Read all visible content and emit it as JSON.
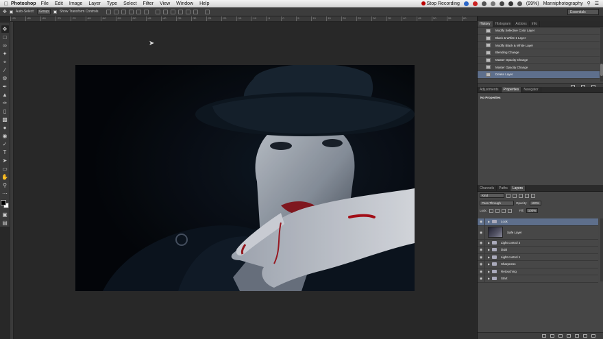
{
  "menubar": {
    "app": "Photoshop",
    "menus": [
      "File",
      "Edit",
      "Image",
      "Layer",
      "Type",
      "Select",
      "Filter",
      "View",
      "Window",
      "Help"
    ],
    "stop_recording": "Stop Recording",
    "battery": "(99%)",
    "user": "Manniphotography"
  },
  "options": {
    "auto_select": "Auto-Select:",
    "group": "Group",
    "show_transform": "Show Transform Controls",
    "workspace": "Essentials"
  },
  "ruler": {
    "ticks": [
      "-90",
      "-85",
      "-80",
      "-75",
      "-70",
      "-65",
      "-60",
      "-55",
      "-50",
      "-45",
      "-40",
      "-35",
      "-30",
      "-25",
      "-20",
      "-15",
      "-10",
      "-5",
      "0",
      "5",
      "10",
      "15",
      "20",
      "25",
      "30",
      "35",
      "40",
      "45",
      "50",
      "55",
      "60"
    ]
  },
  "history": {
    "tabs": [
      "History",
      "Histogram",
      "Actions",
      "Info"
    ],
    "items": [
      "Modify Selective Color Layer",
      "Black & White 1 Layer",
      "Modify Black & White Layer",
      "Blending Change",
      "Master Opacity Change",
      "Master Opacity Change",
      "Delete Layer"
    ],
    "selected_index": 6
  },
  "properties": {
    "tabs": [
      "Adjustments",
      "Properties",
      "Navigator"
    ],
    "empty_text": "No Properties"
  },
  "layers": {
    "tabs": [
      "Channels",
      "Paths",
      "Layers"
    ],
    "kind": "Kind",
    "blend_mode": "Pass Through",
    "opacity_label": "Opacity:",
    "opacity_value": "100%",
    "lock_label": "Lock:",
    "fill_label": "Fill:",
    "fill_value": "100%",
    "items": [
      {
        "name": "Look",
        "type": "group",
        "selected": true
      },
      {
        "name": "Safe Layer",
        "type": "image",
        "selected": false
      },
      {
        "name": "Light control 2",
        "type": "group",
        "selected": false
      },
      {
        "name": "D&B",
        "type": "group",
        "selected": false
      },
      {
        "name": "Light control 1",
        "type": "group",
        "selected": false
      },
      {
        "name": "Sharpness",
        "type": "group",
        "selected": false
      },
      {
        "name": "Retouching",
        "type": "group",
        "selected": false
      },
      {
        "name": "Start",
        "type": "group",
        "selected": false
      }
    ]
  }
}
